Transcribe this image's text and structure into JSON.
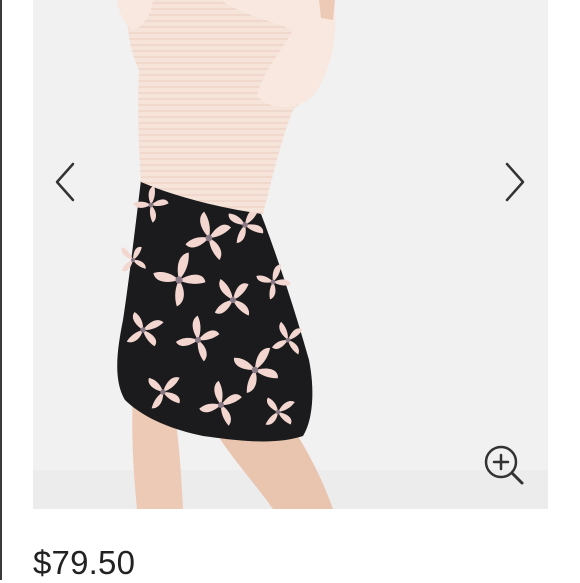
{
  "gallery": {
    "prev_icon": "chevron-left-icon",
    "next_icon": "chevron-right-icon",
    "zoom_icon": "zoom-in-icon"
  },
  "product": {
    "price": "$79.50"
  },
  "colors": {
    "background": "#f1f1f2",
    "sweater": "#f6e3d9",
    "skirt": "#1b1b1d",
    "floral": "#f3d6cf",
    "skin": "#edcab6",
    "icon": "#333333"
  }
}
